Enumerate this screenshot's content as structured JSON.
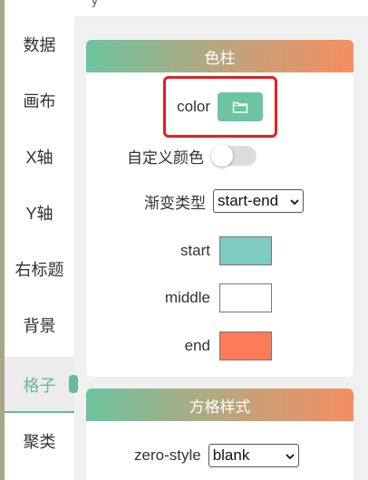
{
  "top_fragment": "y",
  "sidebar": {
    "items": [
      {
        "label": "数据"
      },
      {
        "label": "画布"
      },
      {
        "label": "X轴"
      },
      {
        "label": "Y轴"
      },
      {
        "label": "右标题"
      },
      {
        "label": "背景"
      },
      {
        "label": "格子",
        "active": true
      },
      {
        "label": "聚类"
      }
    ]
  },
  "colorbar_panel": {
    "title": "色柱",
    "color_label": "color",
    "custom_color_label": "自定义颜色",
    "custom_color_enabled": false,
    "gradient_type_label": "渐变类型",
    "gradient_type_value": "start-end",
    "start_label": "start",
    "start_color": "#7ecbc4",
    "middle_label": "middle",
    "middle_color": "#ffffff",
    "end_label": "end",
    "end_color": "#fc7c59"
  },
  "grid_panel": {
    "title": "方格样式",
    "zero_style_label": "zero-style",
    "zero_style_value": "blank"
  },
  "colors": {
    "accent": "#67b99a",
    "highlight": "#e52020"
  }
}
